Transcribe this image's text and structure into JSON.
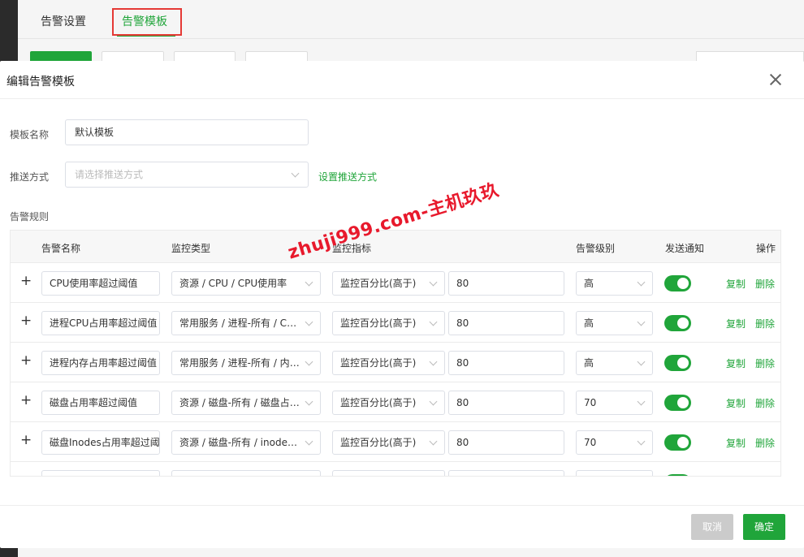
{
  "background": {
    "tabs": [
      {
        "label": "告警设置"
      },
      {
        "label": "告警模板"
      }
    ]
  },
  "modal": {
    "title": "编辑告警模板",
    "template_name_label": "模板名称",
    "template_name_value": "默认模板",
    "push_method_label": "推送方式",
    "push_method_placeholder": "请选择推送方式",
    "push_method_link": "设置推送方式",
    "rules_label": "告警规则",
    "columns": {
      "name": "告警名称",
      "monitor_type": "监控类型",
      "metric": "监控指标",
      "level": "告警级别",
      "notify": "发送通知",
      "actions": "操作"
    },
    "rows": [
      {
        "name": "CPU使用率超过阈值",
        "monitor_type": "资源 / CPU / CPU使用率",
        "metric": "监控百分比(高于)",
        "threshold": "80",
        "level": "高",
        "notify": true
      },
      {
        "name": "进程CPU占用率超过阈值",
        "monitor_type": "常用服务 / 进程-所有 / CPU占用率",
        "metric": "监控百分比(高于)",
        "threshold": "80",
        "level": "高",
        "notify": true
      },
      {
        "name": "进程内存占用率超过阈值",
        "monitor_type": "常用服务 / 进程-所有 / 内存占用率",
        "metric": "监控百分比(高于)",
        "threshold": "80",
        "level": "高",
        "notify": true
      },
      {
        "name": "磁盘占用率超过阈值",
        "monitor_type": "资源 / 磁盘-所有 / 磁盘占用率",
        "metric": "监控百分比(高于)",
        "threshold": "80",
        "level": "70",
        "notify": true
      },
      {
        "name": "磁盘Inodes占用率超过阈值",
        "monitor_type": "资源 / 磁盘-所有 / inodes占用率",
        "metric": "监控百分比(高于)",
        "threshold": "80",
        "level": "70",
        "notify": true
      }
    ],
    "copy_label": "复制",
    "delete_label": "删除",
    "add_symbol": "+",
    "cancel_label": "取消",
    "ok_label": "确定"
  },
  "watermark": "zhuji999.com-主机玖玖",
  "colors": {
    "accent": "#20a53a",
    "highlight": "#e53935",
    "watermark": "#e8192c"
  }
}
